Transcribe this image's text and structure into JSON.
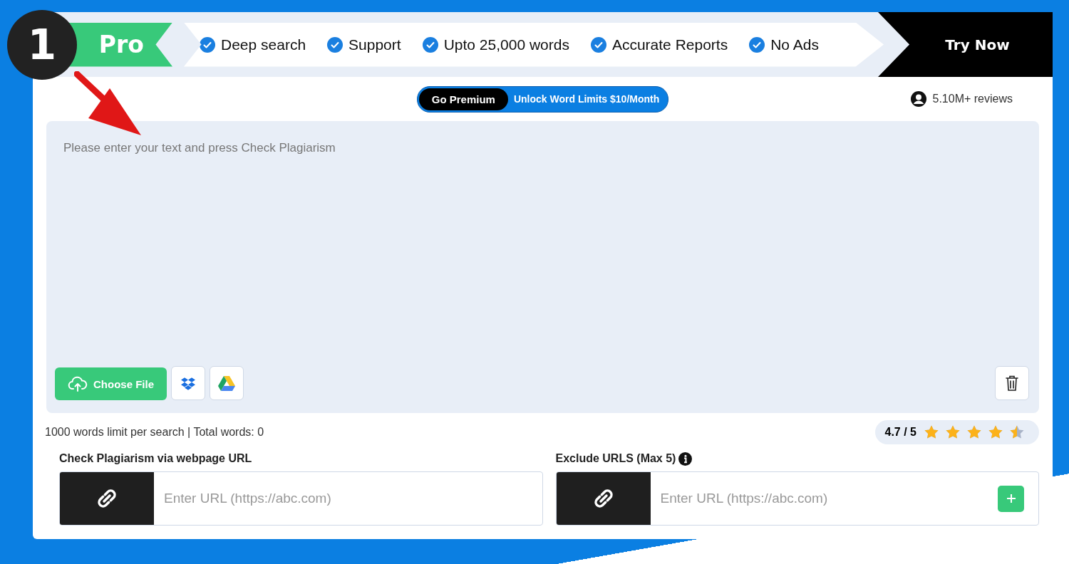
{
  "annotation": {
    "step": "1"
  },
  "promo": {
    "ribbon": "Pro",
    "features": [
      "Deep search",
      "Support",
      "Upto 25,000 words",
      "Accurate Reports",
      "No Ads"
    ],
    "cta": "Try Now"
  },
  "premium": {
    "badge": "Go Premium",
    "offer": "Unlock Word Limits $10/Month"
  },
  "reviews": "5.10M+ reviews",
  "editor": {
    "placeholder": "Please enter your text and press Check Plagiarism",
    "upload": "Choose File"
  },
  "word_count": "1000 words limit per search | Total words: 0",
  "rating": {
    "score": "4.7 / 5",
    "stars": 4.5
  },
  "url_check": {
    "label": "Check Plagiarism via webpage URL",
    "placeholder": "Enter URL (https://abc.com)"
  },
  "exclude": {
    "label": "Exclude URLS (Max 5)",
    "placeholder": "Enter URL (https://abc.com)"
  }
}
